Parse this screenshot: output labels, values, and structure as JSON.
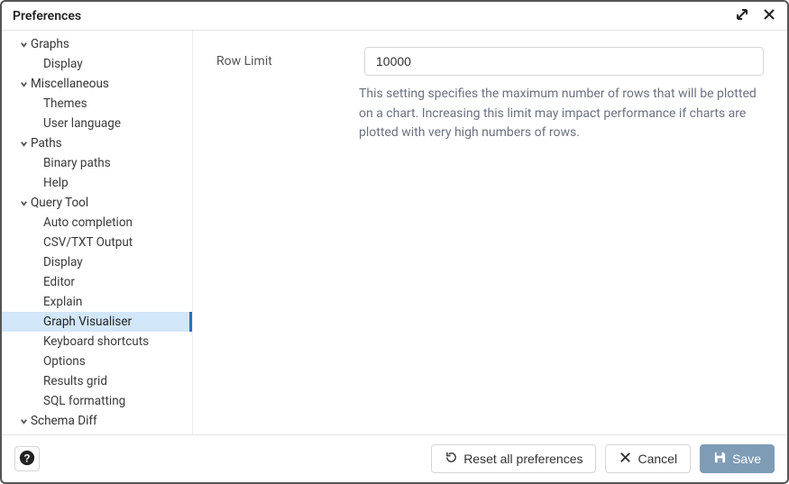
{
  "title": "Preferences",
  "sidebar": {
    "groups": [
      {
        "name": "graphs",
        "label": "Graphs",
        "items": [
          {
            "name": "display",
            "label": "Display"
          }
        ]
      },
      {
        "name": "miscellaneous",
        "label": "Miscellaneous",
        "items": [
          {
            "name": "themes",
            "label": "Themes"
          },
          {
            "name": "user-language",
            "label": "User language"
          }
        ]
      },
      {
        "name": "paths",
        "label": "Paths",
        "items": [
          {
            "name": "binary-paths",
            "label": "Binary paths"
          },
          {
            "name": "help",
            "label": "Help"
          }
        ]
      },
      {
        "name": "query-tool",
        "label": "Query Tool",
        "items": [
          {
            "name": "auto-completion",
            "label": "Auto completion"
          },
          {
            "name": "csv-txt-output",
            "label": "CSV/TXT Output"
          },
          {
            "name": "display",
            "label": "Display"
          },
          {
            "name": "editor",
            "label": "Editor"
          },
          {
            "name": "explain",
            "label": "Explain"
          },
          {
            "name": "graph-visualiser",
            "label": "Graph Visualiser",
            "selected": true
          },
          {
            "name": "keyboard-shortcuts",
            "label": "Keyboard shortcuts"
          },
          {
            "name": "options",
            "label": "Options"
          },
          {
            "name": "results-grid",
            "label": "Results grid"
          },
          {
            "name": "sql-formatting",
            "label": "SQL formatting"
          }
        ]
      },
      {
        "name": "schema-diff",
        "label": "Schema Diff",
        "items": []
      }
    ]
  },
  "form": {
    "row_limit": {
      "label": "Row Limit",
      "value": "10000",
      "help": "This setting specifies the maximum number of rows that will be plotted on a chart. Increasing this limit may impact performance if charts are plotted with very high numbers of rows."
    }
  },
  "footer": {
    "reset_label": "Reset all preferences",
    "cancel_label": "Cancel",
    "save_label": "Save"
  }
}
